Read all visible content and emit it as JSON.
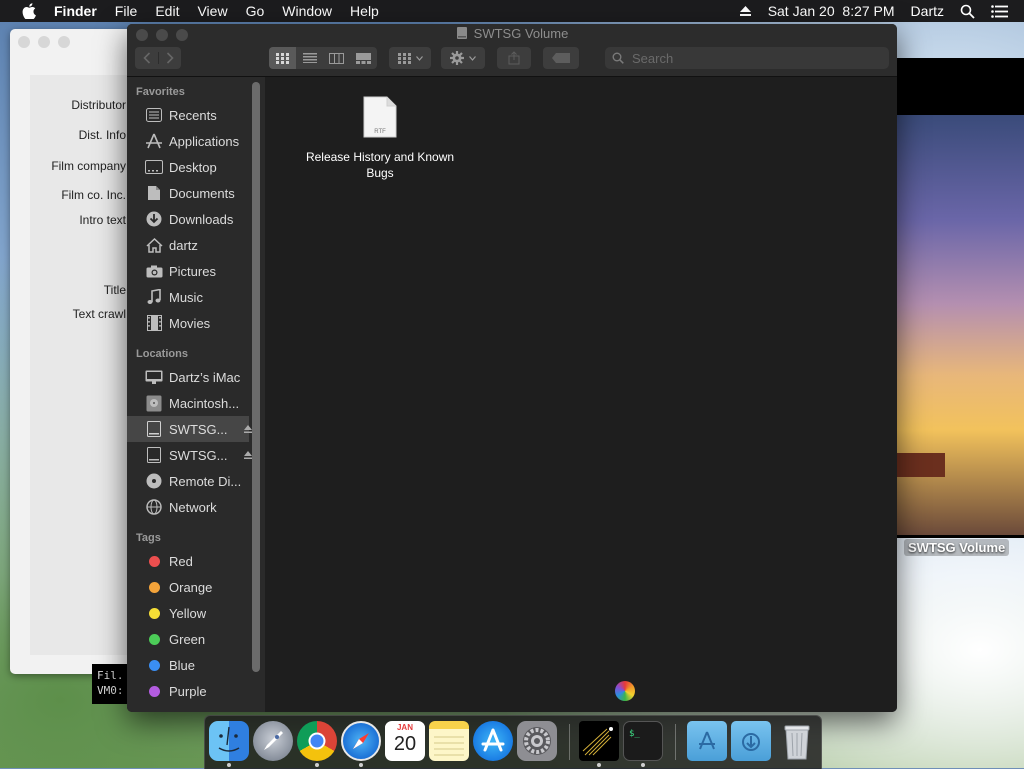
{
  "menubar": {
    "app_name": "Finder",
    "menus": [
      "File",
      "Edit",
      "View",
      "Go",
      "Window",
      "Help"
    ],
    "datetime": "Sat Jan 20  8:27 PM",
    "user": "Dartz"
  },
  "background_window": {
    "labels": [
      "Distributor",
      "Dist. Info",
      "Film company",
      "Film co. Inc.",
      "Intro text",
      "Title",
      "Text crawl"
    ]
  },
  "terminal_snippet": {
    "lines": [
      "Fil.",
      "VM0:"
    ]
  },
  "image_window": {
    "volume_label": "SWTSG Volume"
  },
  "finder": {
    "title": "SWTSG Volume",
    "search_placeholder": "Search",
    "sidebar": {
      "favorites_header": "Favorites",
      "favorites": [
        {
          "label": "Recents",
          "icon": "recents-icon"
        },
        {
          "label": "Applications",
          "icon": "applications-icon"
        },
        {
          "label": "Desktop",
          "icon": "desktop-icon"
        },
        {
          "label": "Documents",
          "icon": "documents-icon"
        },
        {
          "label": "Downloads",
          "icon": "downloads-icon"
        },
        {
          "label": "dartz",
          "icon": "home-icon"
        },
        {
          "label": "Pictures",
          "icon": "camera-icon"
        },
        {
          "label": "Music",
          "icon": "music-icon"
        },
        {
          "label": "Movies",
          "icon": "film-icon"
        }
      ],
      "locations_header": "Locations",
      "locations": [
        {
          "label": "Dartz’s iMac",
          "icon": "imac-icon"
        },
        {
          "label": "Macintosh...",
          "icon": "hard-drive-icon"
        },
        {
          "label": "SWTSG...",
          "icon": "disk-icon",
          "selected": true,
          "ejectable": true
        },
        {
          "label": "SWTSG...",
          "icon": "disk-icon",
          "ejectable": true
        },
        {
          "label": "Remote Di...",
          "icon": "remote-disc-icon"
        },
        {
          "label": "Network",
          "icon": "network-icon"
        }
      ],
      "tags_header": "Tags",
      "tags": [
        {
          "label": "Red",
          "color": "#ec4f4f"
        },
        {
          "label": "Orange",
          "color": "#f3a33a"
        },
        {
          "label": "Yellow",
          "color": "#f5de36"
        },
        {
          "label": "Green",
          "color": "#4ccc58"
        },
        {
          "label": "Blue",
          "color": "#3a8ef2"
        },
        {
          "label": "Purple",
          "color": "#b35ce0"
        }
      ]
    },
    "files": [
      {
        "name": "Release History and Known Bugs",
        "type_label": "RTF",
        "icon": "rtf-file-icon"
      }
    ]
  },
  "dock": {
    "calendar_month": "JAN",
    "calendar_day": "20",
    "apps": [
      "finder",
      "launchpad",
      "chrome",
      "safari",
      "calendar",
      "notes",
      "app-store",
      "system-preferences",
      "fireworks",
      "terminal",
      "applications-folder",
      "downloads-folder",
      "trash"
    ]
  }
}
